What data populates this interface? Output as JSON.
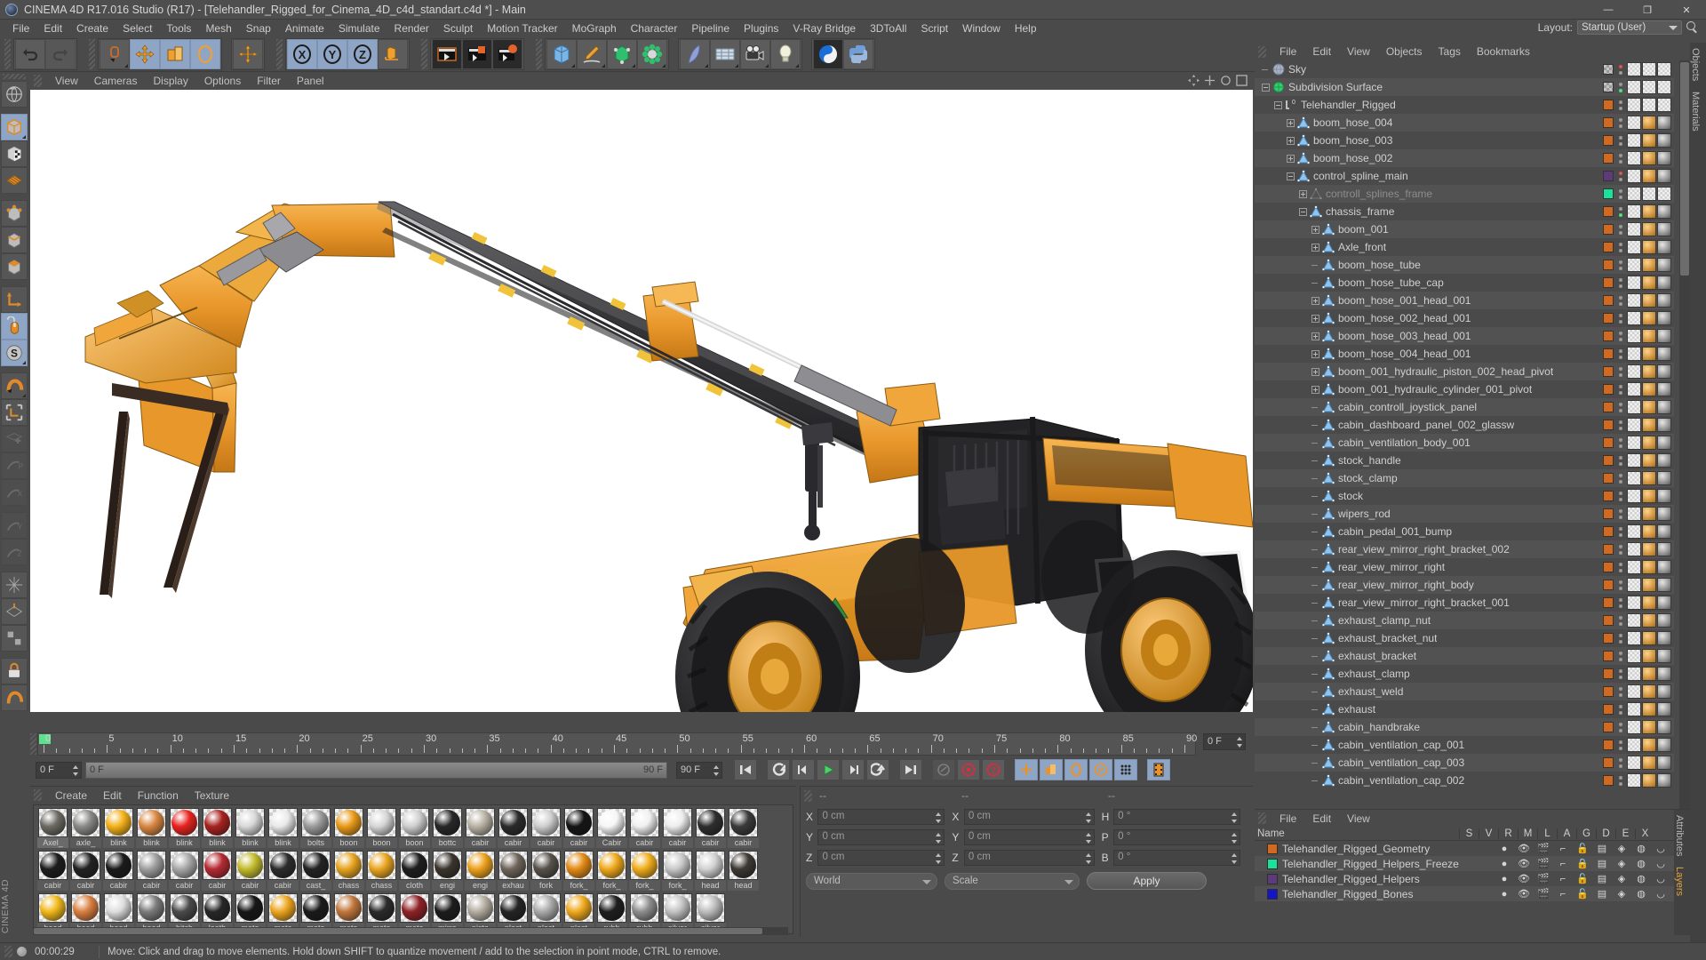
{
  "window": {
    "title": "CINEMA 4D R17.016 Studio (R17) - [Telehandler_Rigged_for_Cinema_4D_c4d_standart.c4d *] - Main",
    "minimize": "—",
    "maximize": "❐",
    "close": "✕"
  },
  "menubar": {
    "items": [
      "File",
      "Edit",
      "Create",
      "Select",
      "Tools",
      "Mesh",
      "Snap",
      "Animate",
      "Simulate",
      "Render",
      "Sculpt",
      "Motion Tracker",
      "MoGraph",
      "Character",
      "Pipeline",
      "Plugins",
      "V-Ray Bridge",
      "3DToAll",
      "Script",
      "Window",
      "Help"
    ],
    "layout_label": "Layout:",
    "layout_value": "Startup (User)"
  },
  "viewport": {
    "menu": [
      "View",
      "Cameras",
      "Display",
      "Options",
      "Filter",
      "Panel"
    ],
    "subject": "Telehandler (JCB-style) rigged 3D model on white background"
  },
  "timeline": {
    "ticks": [
      0,
      5,
      10,
      15,
      20,
      25,
      30,
      35,
      40,
      45,
      50,
      55,
      60,
      65,
      70,
      75,
      80,
      85,
      90
    ],
    "current_frame": "0 F",
    "start_field": "0 F",
    "scrub_left": "0 F",
    "scrub_right": "90 F",
    "end_field": "90 F",
    "range_end": "0 F"
  },
  "materials": {
    "menu": [
      "Create",
      "Edit",
      "Function",
      "Texture"
    ],
    "items": [
      {
        "name": "Axel_",
        "color": "#6d6a63"
      },
      {
        "name": "axle_",
        "color": "#8a8a88"
      },
      {
        "name": "blink",
        "color": "#f5b119"
      },
      {
        "name": "blink",
        "color": "#d98741"
      },
      {
        "name": "blink",
        "color": "#e8231f"
      },
      {
        "name": "blink",
        "color": "#a8221f"
      },
      {
        "name": "blink",
        "color": "#d8d8d8"
      },
      {
        "name": "blink",
        "color": "#e9e9e9"
      },
      {
        "name": "bolts",
        "color": "#9b9b9b"
      },
      {
        "name": "boon",
        "color": "#e99a17"
      },
      {
        "name": "boon",
        "color": "#d6d6d6"
      },
      {
        "name": "boon",
        "color": "#cfcfcf"
      },
      {
        "name": "bottc",
        "color": "#272727"
      },
      {
        "name": "cabir",
        "color": "#b9b2a4"
      },
      {
        "name": "cabir",
        "color": "#2b2b2b"
      },
      {
        "name": "cabir",
        "color": "#cfcfcf"
      },
      {
        "name": "cabir",
        "color": "#151515"
      },
      {
        "name": "Cabir",
        "color": "#f6f6f6"
      },
      {
        "name": "cabir",
        "color": "#f0f0f0"
      },
      {
        "name": "cabir",
        "color": "#ededed"
      },
      {
        "name": "cabir",
        "color": "#2e2e2e"
      },
      {
        "name": "cabir",
        "color": "#3a3a3a"
      },
      {
        "name": "cabir",
        "color": "#1d1d1d"
      },
      {
        "name": "cabir",
        "color": "#222222"
      },
      {
        "name": "cabir",
        "color": "#1b1b1b"
      },
      {
        "name": "cabir",
        "color": "#9e9e9e"
      },
      {
        "name": "cabir",
        "color": "#a8a8a8"
      },
      {
        "name": "cabir",
        "color": "#b52a33"
      },
      {
        "name": "cabir",
        "color": "#c2bb2c"
      },
      {
        "name": "cabir",
        "color": "#2c2c2c"
      },
      {
        "name": "cast_",
        "color": "#232323"
      },
      {
        "name": "chass",
        "color": "#e8a41e"
      },
      {
        "name": "chass",
        "color": "#e9a520"
      },
      {
        "name": "cloth",
        "color": "#1e1e1e"
      },
      {
        "name": "engi",
        "color": "#3a342c"
      },
      {
        "name": "engi",
        "color": "#eda11c"
      },
      {
        "name": "exhau",
        "color": "#6e655a"
      },
      {
        "name": "fork",
        "color": "#56514a"
      },
      {
        "name": "fork_",
        "color": "#e38b15"
      },
      {
        "name": "fork_",
        "color": "#efa81a"
      },
      {
        "name": "fork_",
        "color": "#f0ad1c"
      },
      {
        "name": "fork_",
        "color": "#c9c9c9"
      },
      {
        "name": "head",
        "color": "#d2d2d2"
      },
      {
        "name": "head",
        "color": "#3c3832"
      },
      {
        "name": "head",
        "color": "#f2b81a"
      },
      {
        "name": "head",
        "color": "#d97e3f"
      },
      {
        "name": "head",
        "color": "#dedede"
      },
      {
        "name": "head",
        "color": "#7a7a7a"
      },
      {
        "name": "hitch",
        "color": "#4a4a4a"
      },
      {
        "name": "leath",
        "color": "#272727"
      },
      {
        "name": "meta",
        "color": "#161616"
      },
      {
        "name": "meta",
        "color": "#eda51e"
      },
      {
        "name": "meta",
        "color": "#1a1a1a"
      },
      {
        "name": "meta",
        "color": "#c0763c"
      },
      {
        "name": "meta",
        "color": "#2b2b2b"
      },
      {
        "name": "meta",
        "color": "#8e2226"
      },
      {
        "name": "mirro",
        "color": "#1c1c1c"
      },
      {
        "name": "pisto",
        "color": "#b3aca0"
      },
      {
        "name": "plast",
        "color": "#242424"
      },
      {
        "name": "plast",
        "color": "#a9a9a9"
      },
      {
        "name": "plast",
        "color": "#efa81c"
      },
      {
        "name": "rubb",
        "color": "#1e1e1e"
      },
      {
        "name": "rubb",
        "color": "#8c8c8c"
      },
      {
        "name": "silver",
        "color": "#c3c3c3"
      },
      {
        "name": "silver",
        "color": "#bdbdbd"
      }
    ]
  },
  "coordinates": {
    "col_headers": [
      "--",
      "--",
      "--"
    ],
    "position": {
      "label_x": "X",
      "label_y": "Y",
      "label_z": "Z",
      "x": "0 cm",
      "y": "0 cm",
      "z": "0 cm"
    },
    "size": {
      "label_x": "X",
      "label_y": "Y",
      "label_z": "Z",
      "x": "0 cm",
      "y": "0 cm",
      "z": "0 cm"
    },
    "rotation": {
      "label_h": "H",
      "label_p": "P",
      "label_b": "B",
      "h": "0 °",
      "p": "0 °",
      "b": "0 °"
    },
    "system": "World",
    "mode": "Scale",
    "apply": "Apply"
  },
  "object_manager": {
    "menu": [
      "File",
      "Edit",
      "View",
      "Objects",
      "Tags",
      "Bookmarks"
    ],
    "rows": [
      {
        "label": "Sky",
        "indent": 0,
        "tree": "tee",
        "icon": "sky",
        "swatch": "checker",
        "dot": "red"
      },
      {
        "label": "Subdivision Surface",
        "indent": 0,
        "tree": "minus",
        "icon": "subdiv",
        "swatch": "checker",
        "dot": "check"
      },
      {
        "label": "Telehandler_Rigged",
        "indent": 1,
        "tree": "minus",
        "icon": "null",
        "swatch": "#d2691e",
        "dot": "grey"
      },
      {
        "label": "boom_hose_004",
        "indent": 2,
        "tree": "plus",
        "icon": "poly",
        "swatch": "#d2691e",
        "dot": "grey"
      },
      {
        "label": "boom_hose_003",
        "indent": 2,
        "tree": "plus",
        "icon": "poly",
        "swatch": "#d2691e",
        "dot": "grey"
      },
      {
        "label": "boom_hose_002",
        "indent": 2,
        "tree": "plus",
        "icon": "poly",
        "swatch": "#d2691e",
        "dot": "grey"
      },
      {
        "label": "control_spline_main",
        "indent": 2,
        "tree": "minus",
        "icon": "poly",
        "swatch": "#5d3a7a",
        "dot": "red"
      },
      {
        "label": "controll_splines_frame",
        "indent": 3,
        "tree": "plus",
        "icon": "spline",
        "swatch": "#19e39a",
        "dot": "grey",
        "dim": true
      },
      {
        "label": "chassis_frame",
        "indent": 3,
        "tree": "minus",
        "icon": "poly",
        "swatch": "#d2691e",
        "dot": "green"
      },
      {
        "label": "boom_001",
        "indent": 4,
        "tree": "plus",
        "icon": "poly",
        "swatch": "#d2691e",
        "dot": "grey"
      },
      {
        "label": "Axle_front",
        "indent": 4,
        "tree": "plus",
        "icon": "poly",
        "swatch": "#d2691e",
        "dot": "grey"
      },
      {
        "label": "boom_hose_tube",
        "indent": 4,
        "tree": "tee",
        "icon": "poly",
        "swatch": "#d2691e",
        "dot": "grey"
      },
      {
        "label": "boom_hose_tube_cap",
        "indent": 4,
        "tree": "tee",
        "icon": "poly",
        "swatch": "#d2691e",
        "dot": "grey"
      },
      {
        "label": "boom_hose_001_head_001",
        "indent": 4,
        "tree": "plus",
        "icon": "poly",
        "swatch": "#d2691e",
        "dot": "grey"
      },
      {
        "label": "boom_hose_002_head_001",
        "indent": 4,
        "tree": "plus",
        "icon": "poly",
        "swatch": "#d2691e",
        "dot": "grey"
      },
      {
        "label": "boom_hose_003_head_001",
        "indent": 4,
        "tree": "plus",
        "icon": "poly",
        "swatch": "#d2691e",
        "dot": "grey"
      },
      {
        "label": "boom_hose_004_head_001",
        "indent": 4,
        "tree": "plus",
        "icon": "poly",
        "swatch": "#d2691e",
        "dot": "grey"
      },
      {
        "label": "boom_001_hydraulic_piston_002_head_pivot",
        "indent": 4,
        "tree": "plus",
        "icon": "poly",
        "swatch": "#d2691e",
        "dot": "grey"
      },
      {
        "label": "boom_001_hydraulic_cylinder_001_pivot",
        "indent": 4,
        "tree": "plus",
        "icon": "poly",
        "swatch": "#d2691e",
        "dot": "grey"
      },
      {
        "label": "cabin_controll_joystick_panel",
        "indent": 4,
        "tree": "tee",
        "icon": "poly",
        "swatch": "#d2691e",
        "dot": "grey"
      },
      {
        "label": "cabin_dashboard_panel_002_glassw",
        "indent": 4,
        "tree": "tee",
        "icon": "poly",
        "swatch": "#d2691e",
        "dot": "grey"
      },
      {
        "label": "cabin_ventilation_body_001",
        "indent": 4,
        "tree": "tee",
        "icon": "poly",
        "swatch": "#d2691e",
        "dot": "grey"
      },
      {
        "label": "stock_handle",
        "indent": 4,
        "tree": "tee",
        "icon": "poly",
        "swatch": "#d2691e",
        "dot": "grey"
      },
      {
        "label": "stock_clamp",
        "indent": 4,
        "tree": "tee",
        "icon": "poly",
        "swatch": "#d2691e",
        "dot": "grey"
      },
      {
        "label": "stock",
        "indent": 4,
        "tree": "tee",
        "icon": "poly",
        "swatch": "#d2691e",
        "dot": "grey"
      },
      {
        "label": "wipers_rod",
        "indent": 4,
        "tree": "tee",
        "icon": "poly",
        "swatch": "#d2691e",
        "dot": "grey"
      },
      {
        "label": "cabin_pedal_001_bump",
        "indent": 4,
        "tree": "tee",
        "icon": "poly",
        "swatch": "#d2691e",
        "dot": "grey"
      },
      {
        "label": "rear_view_mirror_right_bracket_002",
        "indent": 4,
        "tree": "tee",
        "icon": "poly",
        "swatch": "#d2691e",
        "dot": "grey"
      },
      {
        "label": "rear_view_mirror_right",
        "indent": 4,
        "tree": "tee",
        "icon": "poly",
        "swatch": "#d2691e",
        "dot": "grey"
      },
      {
        "label": "rear_view_mirror_right_body",
        "indent": 4,
        "tree": "tee",
        "icon": "poly",
        "swatch": "#d2691e",
        "dot": "grey"
      },
      {
        "label": "rear_view_mirror_right_bracket_001",
        "indent": 4,
        "tree": "tee",
        "icon": "poly",
        "swatch": "#d2691e",
        "dot": "grey"
      },
      {
        "label": "exhaust_clamp_nut",
        "indent": 4,
        "tree": "tee",
        "icon": "poly",
        "swatch": "#d2691e",
        "dot": "grey"
      },
      {
        "label": "exhaust_bracket_nut",
        "indent": 4,
        "tree": "tee",
        "icon": "poly",
        "swatch": "#d2691e",
        "dot": "grey"
      },
      {
        "label": "exhaust_bracket",
        "indent": 4,
        "tree": "tee",
        "icon": "poly",
        "swatch": "#d2691e",
        "dot": "grey"
      },
      {
        "label": "exhaust_clamp",
        "indent": 4,
        "tree": "tee",
        "icon": "poly",
        "swatch": "#d2691e",
        "dot": "grey"
      },
      {
        "label": "exhaust_weld",
        "indent": 4,
        "tree": "tee",
        "icon": "poly",
        "swatch": "#d2691e",
        "dot": "grey"
      },
      {
        "label": "exhaust",
        "indent": 4,
        "tree": "tee",
        "icon": "poly",
        "swatch": "#d2691e",
        "dot": "grey"
      },
      {
        "label": "cabin_handbrake",
        "indent": 4,
        "tree": "tee",
        "icon": "poly",
        "swatch": "#d2691e",
        "dot": "grey"
      },
      {
        "label": "cabin_ventilation_cap_001",
        "indent": 4,
        "tree": "tee",
        "icon": "poly",
        "swatch": "#d2691e",
        "dot": "grey"
      },
      {
        "label": "cabin_ventilation_cap_003",
        "indent": 4,
        "tree": "tee",
        "icon": "poly",
        "swatch": "#d2691e",
        "dot": "grey"
      },
      {
        "label": "cabin_ventilation_cap_002",
        "indent": 4,
        "tree": "tee",
        "icon": "poly",
        "swatch": "#d2691e",
        "dot": "grey"
      }
    ]
  },
  "layer_manager": {
    "menu": [
      "File",
      "Edit",
      "View"
    ],
    "columns": [
      "Name",
      "S",
      "V",
      "R",
      "M",
      "L",
      "A",
      "G",
      "D",
      "E",
      "X"
    ],
    "rows": [
      {
        "name": "Telehandler_Rigged_Geometry",
        "color": "#d2691e",
        "locked": false
      },
      {
        "name": "Telehandler_Rigged_Helpers_Freeze",
        "color": "#19e39a",
        "locked": true
      },
      {
        "name": "Telehandler_Rigged_Helpers",
        "color": "#5d3a7a",
        "locked": false
      },
      {
        "name": "Telehandler_Rigged_Bones",
        "color": "#1414c8",
        "locked": false
      }
    ],
    "side_tabs": [
      "Attributes",
      "Layers"
    ]
  },
  "right_edge_tabs": [
    "Objects",
    "Materials",
    "CINEMA 4D"
  ],
  "statusbar": {
    "time": "00:00:29",
    "message": "Move: Click and drag to move elements. Hold down SHIFT to quantize movement / add to the selection in point mode, CTRL to remove."
  }
}
